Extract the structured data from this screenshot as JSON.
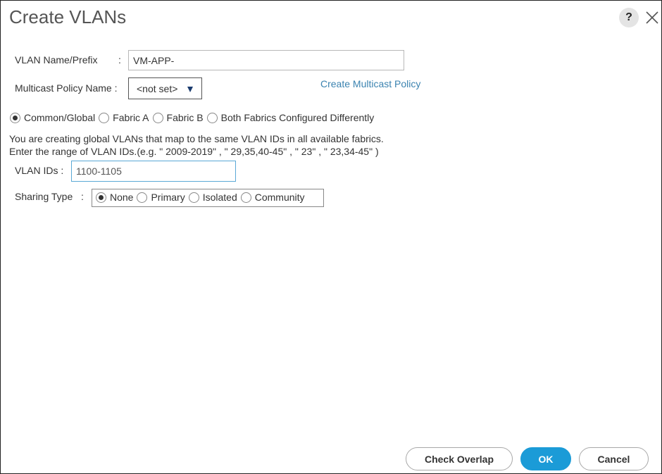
{
  "dialog": {
    "title": "Create VLANs",
    "help_label": "?"
  },
  "vlan_name": {
    "label": "VLAN Name/Prefix",
    "colon": ":",
    "value": "VM-APP-"
  },
  "multicast": {
    "label": "Multicast Policy Name :",
    "selected": "<not set>",
    "create_link": "Create Multicast Policy"
  },
  "fabric_options": [
    {
      "label": "Common/Global",
      "checked": true
    },
    {
      "label": "Fabric A",
      "checked": false
    },
    {
      "label": "Fabric B",
      "checked": false
    },
    {
      "label": "Both Fabrics Configured Differently",
      "checked": false
    }
  ],
  "info": {
    "line1": "You are creating global VLANs that map to the same VLAN IDs in all available fabrics.",
    "line2": "Enter the range of VLAN IDs.(e.g. \" 2009-2019\" , \" 29,35,40-45\" , \" 23\" , \" 23,34-45\" )"
  },
  "vlan_ids": {
    "label": "VLAN IDs :",
    "value": "1100-1105"
  },
  "sharing": {
    "label": "Sharing Type",
    "colon": ":",
    "options": [
      {
        "label": "None",
        "checked": true
      },
      {
        "label": "Primary",
        "checked": false
      },
      {
        "label": "Isolated",
        "checked": false
      },
      {
        "label": "Community",
        "checked": false
      }
    ]
  },
  "buttons": {
    "check_overlap": "Check Overlap",
    "ok": "OK",
    "cancel": "Cancel"
  },
  "colors": {
    "primary": "#1b9bd7",
    "link": "#3b83b0",
    "focus_border": "#5aa9d6"
  }
}
